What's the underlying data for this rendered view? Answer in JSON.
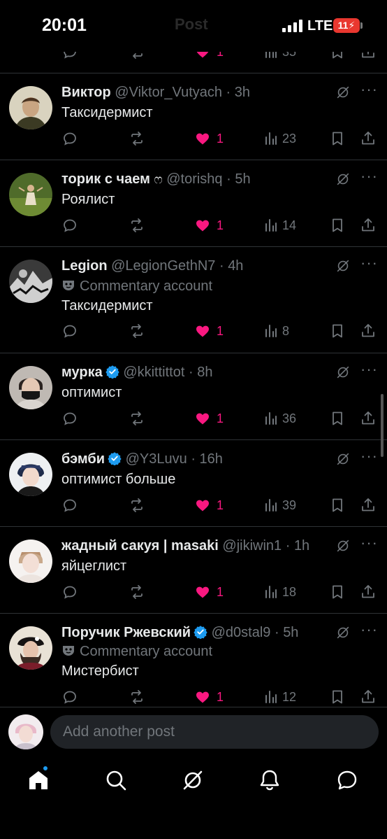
{
  "status_bar": {
    "time": "20:01",
    "ghost_title": "Post",
    "network": "LTE",
    "battery": "11"
  },
  "top_actions": {
    "like_count": "1",
    "views": "35"
  },
  "posts": [
    {
      "name": "Виктор",
      "verified": false,
      "emoji": "",
      "handle": "@Viktor_Vutyach",
      "time": "3h",
      "tag": "",
      "text": "Таксидермист",
      "likes": "1",
      "views": "23"
    },
    {
      "name": "торик с чаем",
      "verified": false,
      "emoji": "ෆ",
      "handle": "@torishq",
      "time": "5h",
      "tag": "",
      "text": "Роялист",
      "likes": "1",
      "views": "14"
    },
    {
      "name": "Legion",
      "verified": false,
      "emoji": "",
      "handle": "@LegionGethN7",
      "time": "4h",
      "tag": "Commentary account",
      "text": "Таксидермист",
      "likes": "1",
      "views": "8"
    },
    {
      "name": "мурка",
      "verified": true,
      "emoji": "",
      "handle": "@kkittittot",
      "time": "8h",
      "tag": "",
      "text": "оптимист",
      "likes": "1",
      "views": "36"
    },
    {
      "name": "бэмби",
      "verified": true,
      "emoji": "",
      "handle": "@Y3Luvu",
      "time": "16h",
      "tag": "",
      "text": "оптимист больше",
      "likes": "1",
      "views": "39"
    },
    {
      "name": "жадный сакуя | masaki",
      "verified": false,
      "emoji": "",
      "handle": "@jikiwin1",
      "time": "1h",
      "tag": "",
      "text": "яйцеглист",
      "likes": "1",
      "views": "18"
    },
    {
      "name": "Поручик Ржевский",
      "verified": true,
      "emoji": "",
      "handle": "@d0stal9",
      "time": "5h",
      "tag": "Commentary account",
      "text": "Мистербист",
      "likes": "1",
      "views": "12"
    }
  ],
  "composer": {
    "placeholder": "Add another post"
  },
  "icons": {
    "reply": "reply-icon",
    "repost": "repost-icon",
    "like": "heart-icon",
    "views": "views-icon",
    "bookmark": "bookmark-icon",
    "share": "share-icon",
    "grok": "grok-icon",
    "more": "more-icon",
    "home": "home-icon",
    "search": "search-icon",
    "notifications": "bell-icon",
    "messages": "messages-icon"
  },
  "colors": {
    "background": "#000000",
    "like": "#f91880",
    "verified": "#1d9bf0",
    "muted": "#71767b",
    "text": "#e7e9ea"
  }
}
